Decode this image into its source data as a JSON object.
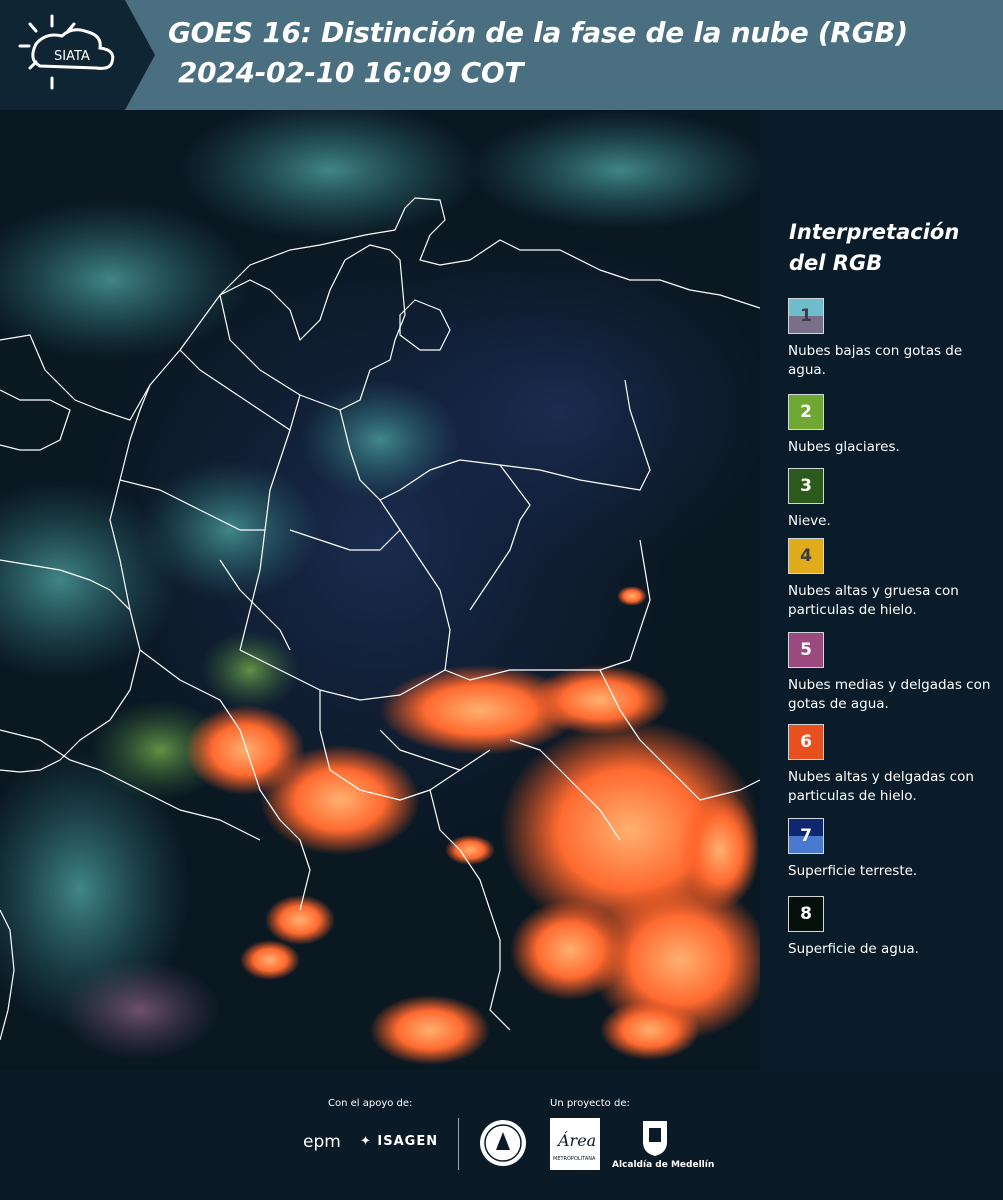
{
  "header": {
    "logo_text": "SIATA",
    "title_line1": "GOES 16: Distinción de la fase de la nube (RGB)",
    "title_line2": "2024-02-10 16:09 COT",
    "colors": {
      "header_bg": "#4a6f80",
      "logo_bg": "#0f2533"
    }
  },
  "map": {
    "icon": "satellite-rgb-map",
    "colors": {
      "boundary": "#ffffff",
      "ice_cloud": "#ff6a35",
      "water_cloud": "#3a8f8f"
    }
  },
  "legend": {
    "title": "Interpretación del RGB",
    "items": [
      {
        "number": "1",
        "label": "Nubes bajas con gotas de agua.",
        "color_top": "#6fbccb",
        "color_bottom": "#7a6f8a",
        "num_color": "#3a3a4a"
      },
      {
        "number": "2",
        "label": "Nubes glaciares.",
        "color_top": "#6ea832",
        "color_bottom": "#6ea832",
        "num_color": "#ffffff"
      },
      {
        "number": "3",
        "label": "Nieve.",
        "color_top": "#2c5a1c",
        "color_bottom": "#2c5a1c",
        "num_color": "#ffffff"
      },
      {
        "number": "4",
        "label": "Nubes altas y gruesa con particulas de hielo.",
        "color_top": "#e0ac1c",
        "color_bottom": "#e0ac1c",
        "num_color": "#3a3a3a"
      },
      {
        "number": "5",
        "label": "Nubes medias y delgadas con gotas de agua.",
        "color_top": "#9a4a7e",
        "color_bottom": "#9a4a7e",
        "num_color": "#ffffff"
      },
      {
        "number": "6",
        "label": "Nubes altas y delgadas con particulas de hielo.",
        "color_top": "#e85020",
        "color_bottom": "#e85020",
        "num_color": "#ffffff"
      },
      {
        "number": "7",
        "label": "Superficie terreste.",
        "color_top": "#0e2870",
        "color_bottom": "#4a7ad0",
        "num_color": "#ffffff"
      },
      {
        "number": "8",
        "label": "Superficie de agua.",
        "color_top": "#05100a",
        "color_bottom": "#05100a",
        "num_color": "#ffffff"
      }
    ]
  },
  "footer": {
    "support_label": "Con el apoyo de:",
    "project_label": "Un proyecto de:",
    "epm_text": "epm",
    "isagen_text": "ISAGEN",
    "area_text": "Área",
    "area_subtext": "METROPOLITANA",
    "alcaldia_text": "Alcaldía de Medellín"
  }
}
